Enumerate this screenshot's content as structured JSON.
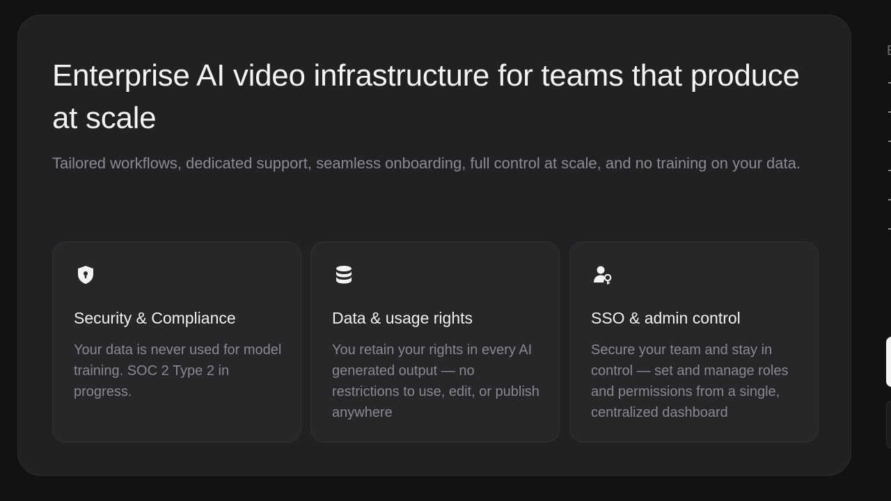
{
  "hero": {
    "title": "Enterprise AI video infrastructure for teams that produce at scale",
    "subtitle": "Tailored workflows, dedicated support, seamless onboarding, full control at scale, and no training on your data."
  },
  "features": [
    {
      "icon": "shield-lock-icon",
      "title": "Security & Compliance",
      "description": "Your data is never used for model training. SOC 2 Type 2 in progress."
    },
    {
      "icon": "database-icon",
      "title": "Data & usage rights",
      "description": "You retain your rights in every AI generated output — no restrictions to use, edit, or publish anywhere"
    },
    {
      "icon": "user-key-icon",
      "title": "SSO & admin control",
      "description": "Secure your team and stay in control — set and manage roles and permissions from a single, centralized dashboard"
    }
  ],
  "side_panel": {
    "letter": "E"
  },
  "colors": {
    "background": "#121213",
    "card": "#212123",
    "feature_card": "#27272a",
    "heading": "#f4f4f5",
    "muted_text": "#8c8c90"
  }
}
